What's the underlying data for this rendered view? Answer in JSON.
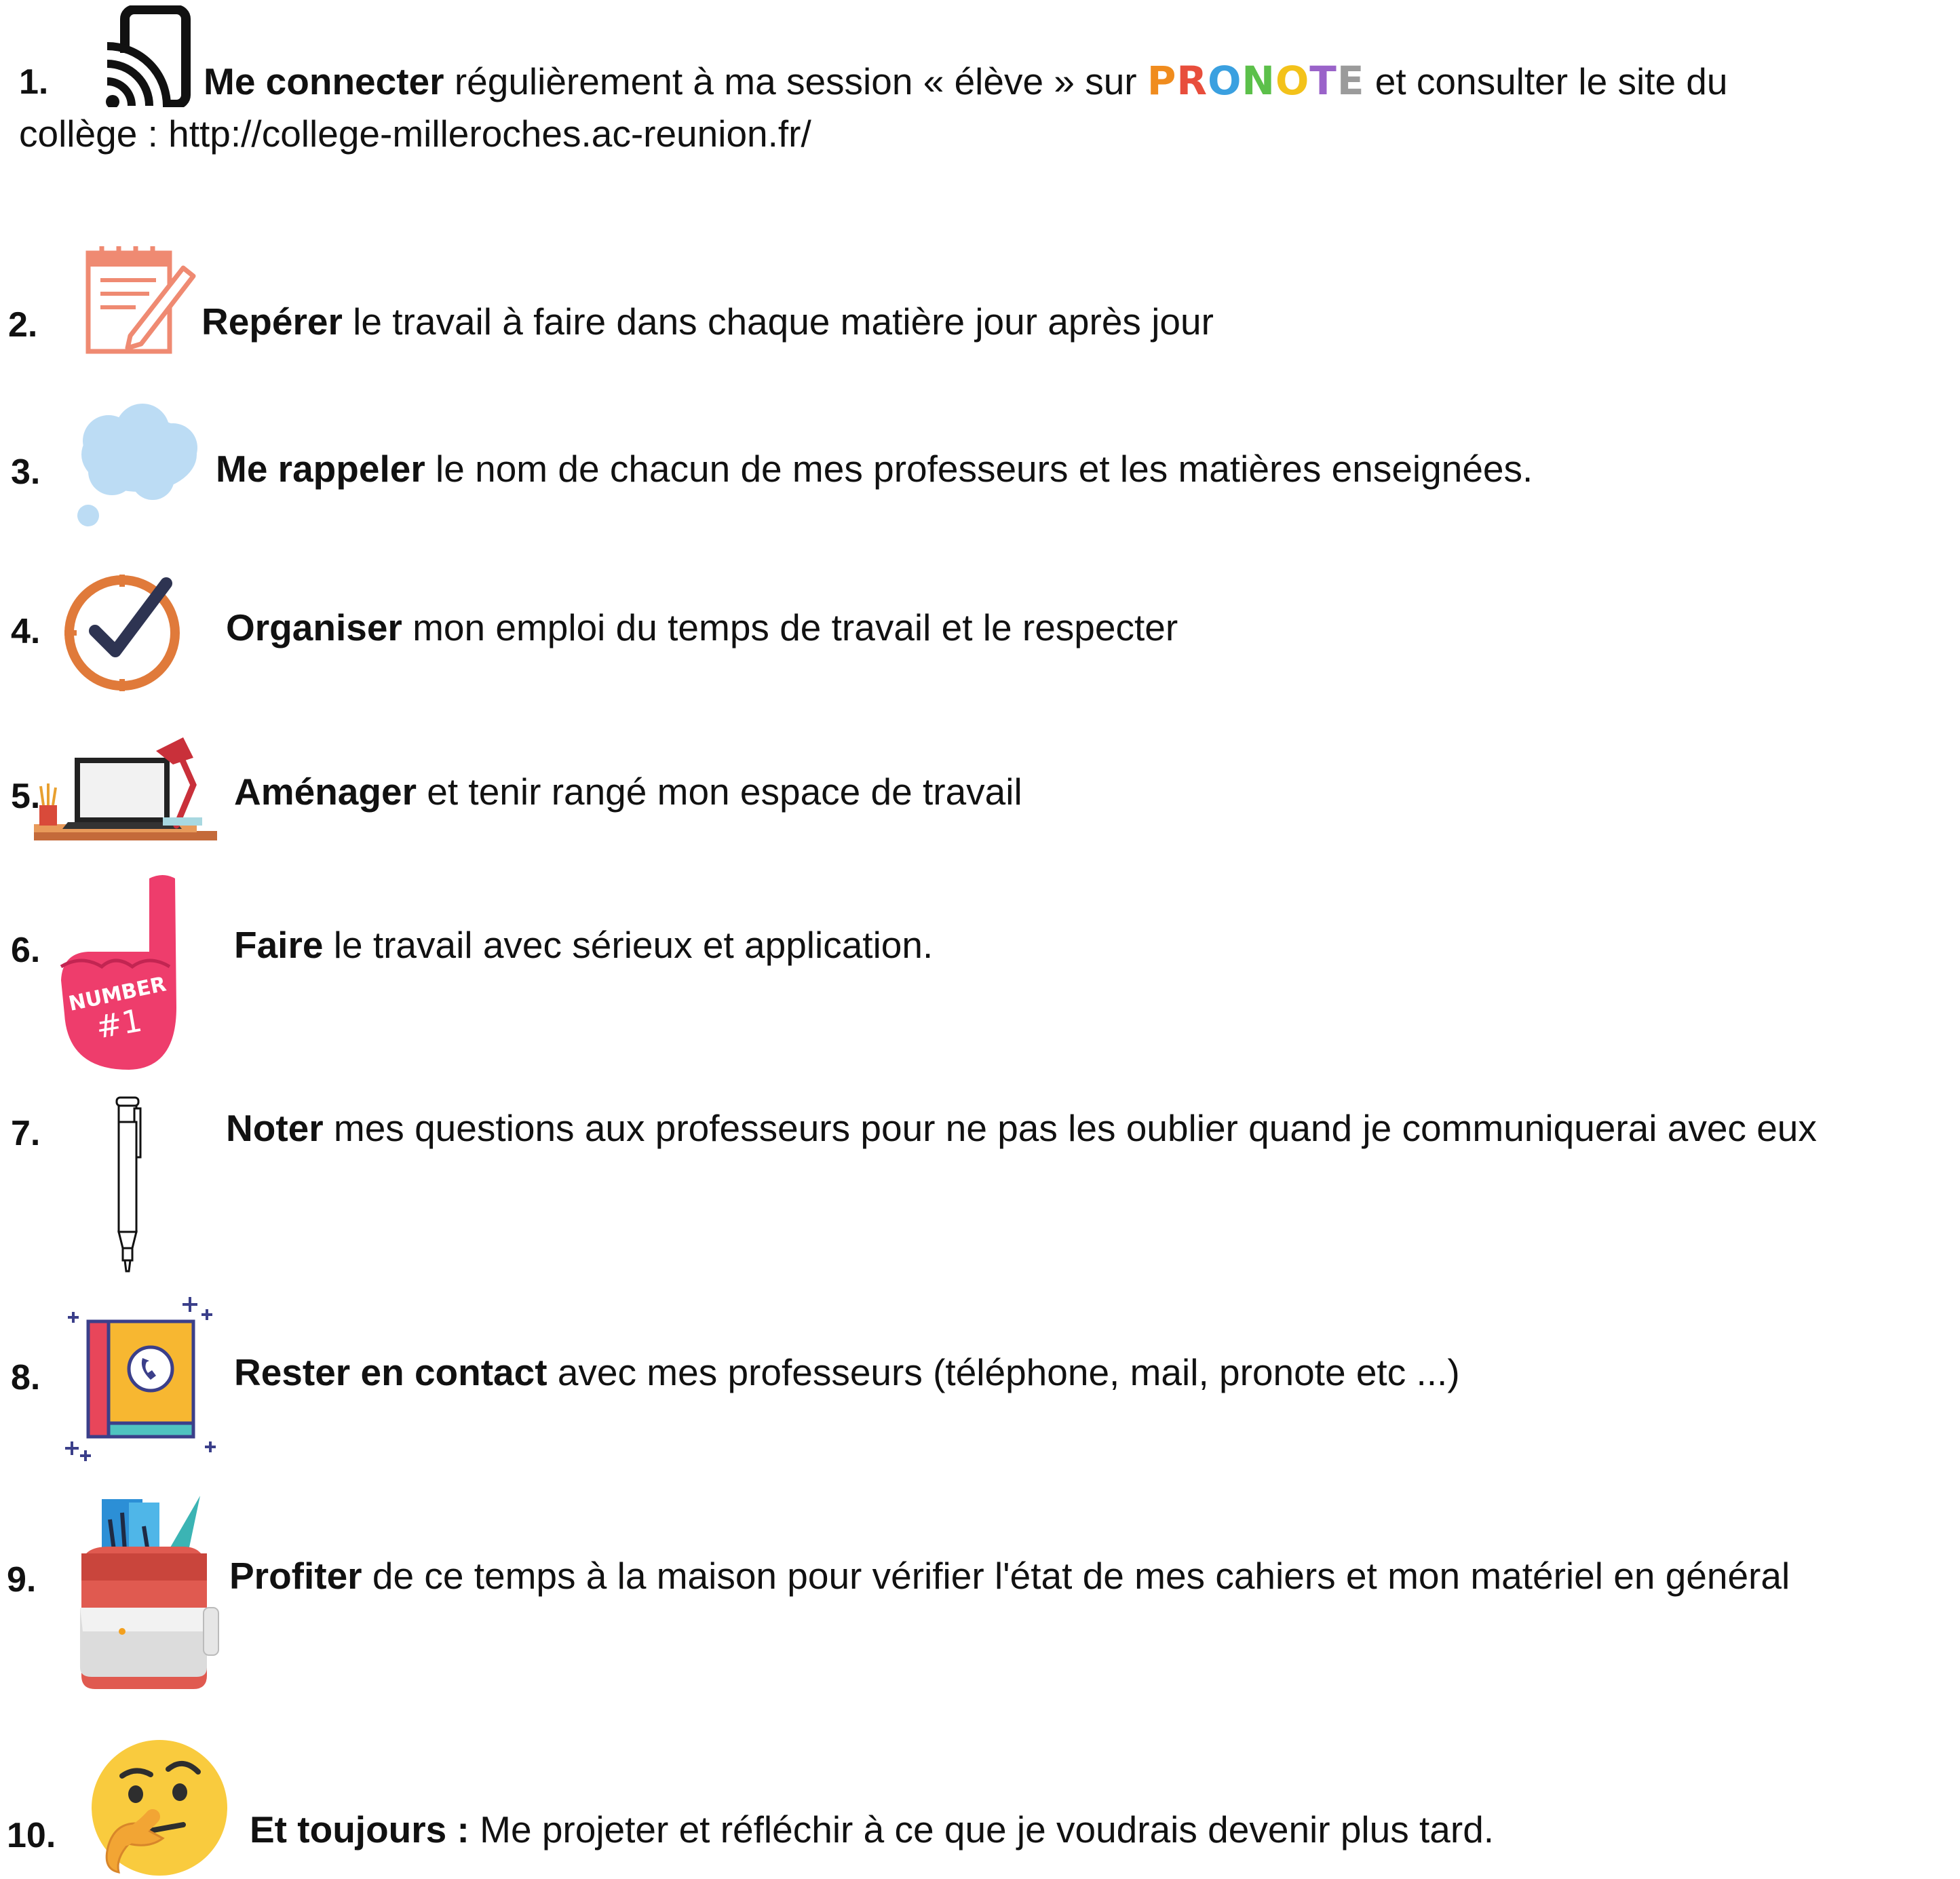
{
  "items": [
    {
      "num": "1.",
      "bold": "Me connecter",
      "text_a": " régulièrement à ma session « élève » sur ",
      "brand": [
        "P",
        "R",
        "O",
        "N",
        "O",
        "T",
        "E"
      ],
      "text_b": " et consulter le site du",
      "text_c": "collège : http://college-milleroches.ac-reunion.fr/",
      "icon": "cast-phone-icon"
    },
    {
      "num": "2.",
      "bold": "Repérer",
      "text": " le travail à faire dans chaque matière jour après jour",
      "icon": "notepad-pencil-icon"
    },
    {
      "num": "3.",
      "bold": "Me rappeler",
      "text": " le nom de chacun de mes professeurs et les matières enseignées.",
      "icon": "thought-cloud-icon"
    },
    {
      "num": "4.",
      "bold": "Organiser",
      "text": " mon emploi du temps de travail et le respecter",
      "icon": "clock-check-icon"
    },
    {
      "num": "5.",
      "bold": "Aménager",
      "text": " et tenir rangé mon espace de travail",
      "icon": "desk-laptop-lamp-icon"
    },
    {
      "num": "6.",
      "bold": "Faire",
      "text": " le travail avec sérieux et application.",
      "icon": "foam-finger-icon",
      "icon_text_a": "NUMBER",
      "icon_text_b": "#1"
    },
    {
      "num": "7.",
      "bold": "Noter",
      "text": " mes questions aux professeurs pour ne pas les oublier quand je communiquerai avec eux",
      "icon": "pen-icon"
    },
    {
      "num": "8.",
      "bold": "Rester en contact",
      "text": " avec mes professeurs (téléphone, mail, pronote etc ...)",
      "icon": "phone-book-icon"
    },
    {
      "num": "9.",
      "bold": "Profiter",
      "text": " de ce temps à la maison pour vérifier l'état de mes cahiers et mon matériel en général",
      "icon": "school-backpack-icon"
    },
    {
      "num": "10.",
      "bold": "Et toujours :",
      "text": " Me projeter et réfléchir à ce que je voudrais devenir plus tard.",
      "icon": "thinking-face-icon"
    }
  ],
  "colors": {
    "pronote": [
      "#f08c1e",
      "#e84e3c",
      "#3aa0e0",
      "#5cc04a",
      "#f3c21a",
      "#9a63c9",
      "#9b9b9b"
    ]
  }
}
